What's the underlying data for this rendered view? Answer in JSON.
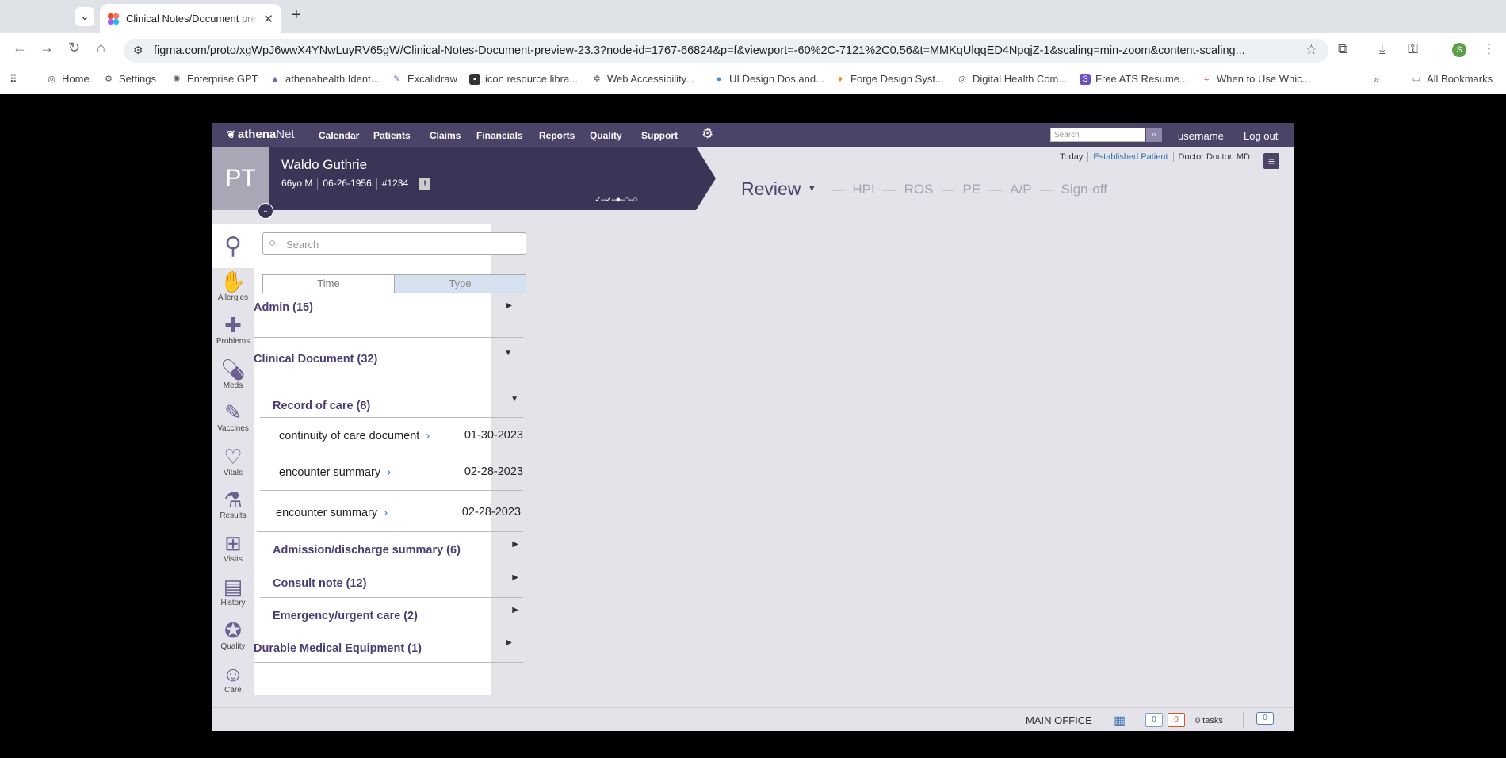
{
  "browser": {
    "tab_title": "Clinical Notes/Document preview 23.3",
    "url": "figma.com/proto/xgWpJ6wwX4YNwLuyRV65gW/Clinical-Notes-Document-preview-23.3?node-id=1767-66824&p=f&viewport=-60%2C-7121%2C0.56&t=MMKqUlqqED4NpqjZ-1&scaling=min-zoom&content-scaling...",
    "profile_initial": "S",
    "bookmarks": [
      "Home",
      "Settings",
      "Enterprise GPT",
      "athenahealth Ident...",
      "Excalidraw",
      "icon resource libra...",
      "Web Accessibility...",
      "UI Design Dos and...",
      "Forge Design Syst...",
      "Digital Health Com...",
      "Free ATS Resume...",
      "When to Use Whic..."
    ],
    "all_bookmarks": "All Bookmarks"
  },
  "app": {
    "logo": {
      "bold": "athena",
      "light": "Net"
    },
    "nav": [
      "Calendar",
      "Patients",
      "Claims",
      "Financials",
      "Reports",
      "Quality",
      "Support"
    ],
    "search_placeholder": "Search",
    "username": "username",
    "logout": "Log out"
  },
  "patient": {
    "initials": "PT",
    "name": "Waldo Guthrie",
    "age_sex": "66yo M",
    "dob": "06-26-1956",
    "id": "#1234",
    "alert": "!",
    "progress": "✓–✓–●–○–○"
  },
  "header": {
    "today": "Today",
    "visit_type": "Established Patient",
    "provider": "Doctor Doctor, MD"
  },
  "steps": {
    "active": "Review",
    "others": [
      "HPI",
      "ROS",
      "PE",
      "A/P",
      "Sign-off"
    ]
  },
  "rail": [
    "Allergies",
    "Problems",
    "Meds",
    "Vaccines",
    "Vitals",
    "Results",
    "Visits",
    "History",
    "Quality",
    "Care"
  ],
  "panel": {
    "search_placeholder": "Search",
    "toggle": [
      "Time",
      "Type"
    ],
    "groups": {
      "admin": "Admin (15)",
      "clinical": "Clinical Document (32)",
      "record": "Record of care (8)",
      "admission": "Admission/discharge summary (6)",
      "consult": "Consult note (12)",
      "emergency": "Emergency/urgent care (2)",
      "dme": "Durable Medical Equipment (1)"
    },
    "docs": [
      {
        "name": "continuity of care document",
        "date": "01-30-2023"
      },
      {
        "name": "encounter summary",
        "date": "02-28-2023"
      },
      {
        "name": "encounter summary",
        "date": "02-28-2023"
      }
    ]
  },
  "status": {
    "office": "MAIN OFFICE",
    "count_blue": "0",
    "count_red": "0",
    "tasks": "0 tasks",
    "messages": "0"
  }
}
